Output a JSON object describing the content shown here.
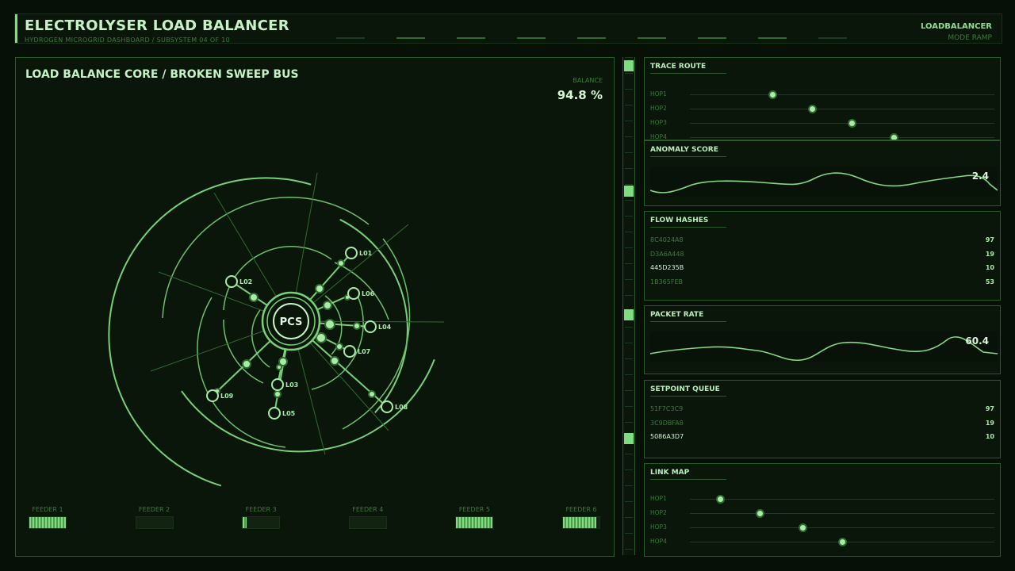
{
  "header": {
    "title": "ELECTROLYSER LOAD BALANCER",
    "subtitle": "HYDROGEN MICROGRID DASHBOARD / SUBSYSTEM 04 OF 10",
    "right_label": "LOADBALANCER",
    "mode": "MODE RAMP"
  },
  "main": {
    "title": "LOAD BALANCE CORE / BROKEN SWEEP BUS",
    "balance_label": "BALANCE",
    "balance_value": "94.8 %",
    "center_label": "PCS",
    "nodes": [
      "L01",
      "L02",
      "L03",
      "L04",
      "L05",
      "L06",
      "L07",
      "L08",
      "L09"
    ],
    "feeders": [
      {
        "label": "FEEDER 1",
        "level": 1.0
      },
      {
        "label": "FEEDER 2",
        "level": 0.0
      },
      {
        "label": "FEEDER 3",
        "level": 0.1
      },
      {
        "label": "FEEDER 4",
        "level": 0.0
      },
      {
        "label": "FEEDER 5",
        "level": 1.0
      },
      {
        "label": "FEEDER 6",
        "level": 0.92
      }
    ]
  },
  "panels": {
    "trace_route": {
      "title": "TRACE ROUTE",
      "hops": [
        {
          "label": "HOP1",
          "level": 0.27
        },
        {
          "label": "HOP2",
          "level": 0.4
        },
        {
          "label": "HOP3",
          "level": 0.53
        },
        {
          "label": "HOP4",
          "level": 0.67
        }
      ]
    },
    "anomaly": {
      "title": "ANOMALY SCORE",
      "value": "2.4"
    },
    "flow_hashes": {
      "title": "FLOW HASHES",
      "rows": [
        {
          "key": "8C4024A8",
          "value": "97"
        },
        {
          "key": "D3A6A448",
          "value": "19"
        },
        {
          "key": "445D235B",
          "value": "10"
        },
        {
          "key": "1B365FEB",
          "value": "53"
        }
      ]
    },
    "packet_rate": {
      "title": "PACKET RATE",
      "value": "60.4"
    },
    "setpoint_queue": {
      "title": "SETPOINT QUEUE",
      "rows": [
        {
          "key": "51F7C3C9",
          "value": "97"
        },
        {
          "key": "3C9DBFA8",
          "value": "19"
        },
        {
          "key": "5086A3D7",
          "value": "10"
        }
      ]
    },
    "link_map": {
      "title": "LINK MAP",
      "hops": [
        {
          "label": "HOP1",
          "level": 0.1
        },
        {
          "label": "HOP2",
          "level": 0.23
        },
        {
          "label": "HOP3",
          "level": 0.37
        },
        {
          "label": "HOP4",
          "level": 0.5
        }
      ]
    }
  },
  "colors": {
    "accent": "#7fdc7f",
    "background": "#071007",
    "panel": "#0b160b",
    "border": "#2a5a2a"
  }
}
